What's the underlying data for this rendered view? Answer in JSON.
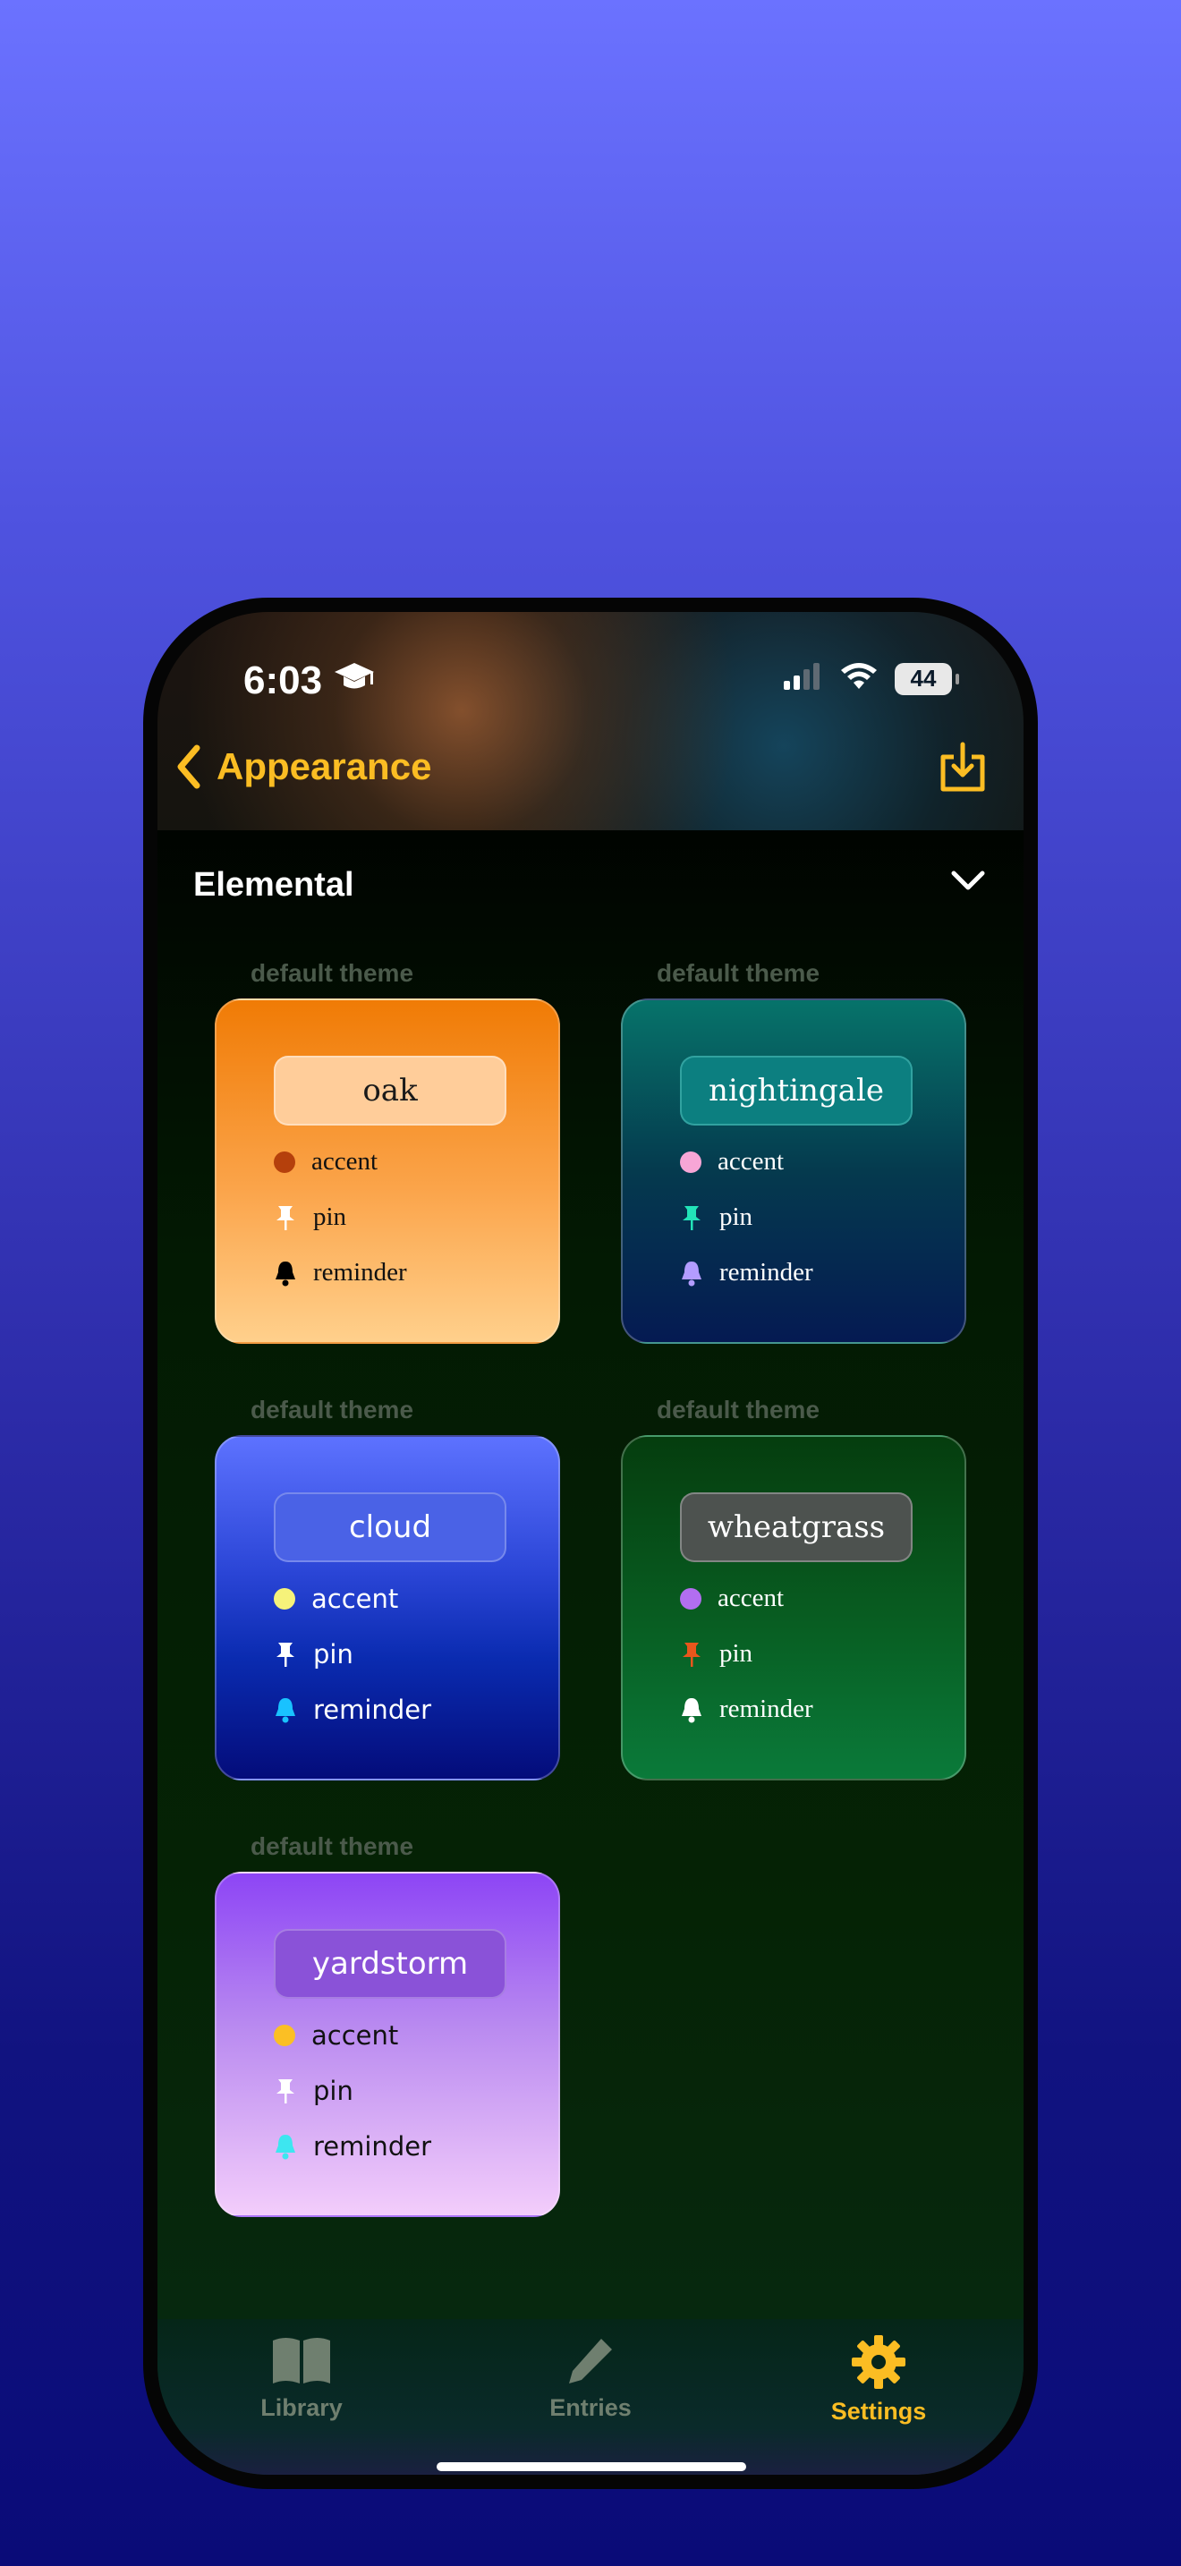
{
  "status_bar": {
    "time": "6:03",
    "battery": "44"
  },
  "nav": {
    "back_label": "Appearance"
  },
  "section": {
    "title": "Elemental"
  },
  "colors": {
    "accent": "#fbbd23",
    "tab_inactive": "#6f7f6f",
    "label": "#4b5a4b"
  },
  "themes": [
    {
      "label": "default theme",
      "name": "oak",
      "rows": [
        "accent",
        "pin",
        "reminder"
      ],
      "text_color": "#111111",
      "accent_color": "#b5400c",
      "pin_color": "#ffffff",
      "reminder_color": "#000000"
    },
    {
      "label": "default theme",
      "name": "nightingale",
      "rows": [
        "accent",
        "pin",
        "reminder"
      ],
      "text_color": "#ffffff",
      "accent_color": "#f7a6d6",
      "pin_color": "#22e3b8",
      "reminder_color": "#b39cff"
    },
    {
      "label": "default theme",
      "name": "cloud",
      "rows": [
        "accent",
        "pin",
        "reminder"
      ],
      "text_color": "#ffffff",
      "accent_color": "#f6f27a",
      "pin_color": "#ffffff",
      "reminder_color": "#19c2ff"
    },
    {
      "label": "default theme",
      "name": "wheatgrass",
      "rows": [
        "accent",
        "pin",
        "reminder"
      ],
      "text_color": "#ffffff",
      "accent_color": "#b26ef0",
      "pin_color": "#e8561c",
      "reminder_color": "#ffffff"
    },
    {
      "label": "default theme",
      "name": "yardstorm",
      "rows": [
        "accent",
        "pin",
        "reminder"
      ],
      "text_color": "#111111",
      "accent_color": "#fbbf24",
      "pin_color": "#ffffff",
      "reminder_color": "#3de6f0"
    }
  ],
  "tabs": [
    {
      "label": "Library",
      "icon": "book-icon",
      "active": false
    },
    {
      "label": "Entries",
      "icon": "pencil-icon",
      "active": false
    },
    {
      "label": "Settings",
      "icon": "gear-icon",
      "active": true
    }
  ]
}
